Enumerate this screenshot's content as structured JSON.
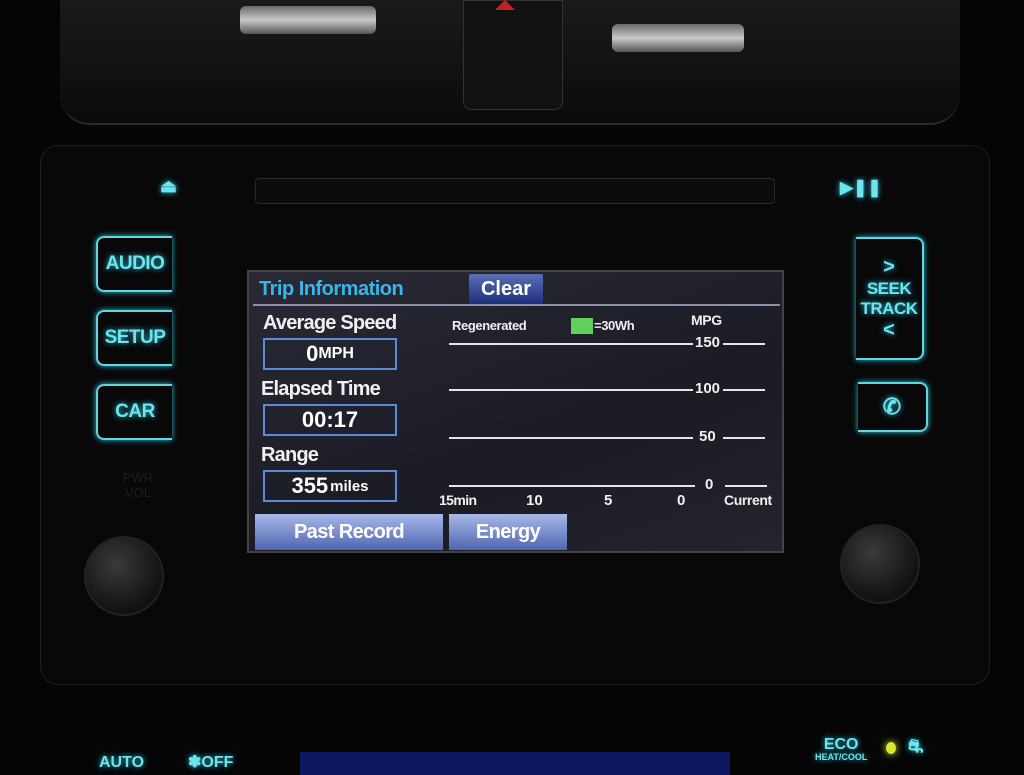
{
  "head_unit": {
    "eject_icon": "eject-icon",
    "play_pause_icon": "play-pause-icon",
    "left_buttons": [
      {
        "label": "AUDIO"
      },
      {
        "label": "SETUP"
      },
      {
        "label": "CAR"
      }
    ],
    "seek_track": {
      "line1": "SEEK",
      "line2": "TRACK"
    },
    "phone_icon": "phone-icon",
    "pwr_vol_label": "PWR VOL",
    "accent_color": "#5fd8e4"
  },
  "screen": {
    "title": "Trip Information",
    "clear_button": "Clear",
    "average_speed": {
      "label": "Average Speed",
      "value": "0",
      "unit": "MPH"
    },
    "elapsed_time": {
      "label": "Elapsed Time",
      "value": "00:17"
    },
    "range": {
      "label": "Range",
      "value": "355",
      "unit": "miles"
    },
    "tabs": [
      {
        "label": "Past Record"
      },
      {
        "label": "Energy"
      }
    ],
    "chart": {
      "regenerated_label": "Regenerated",
      "legend_value": "=30Wh",
      "legend_color": "#5fd05a",
      "y_label": "MPG",
      "y_ticks": [
        "150",
        "100",
        "50",
        "0"
      ],
      "x_ticks": [
        "15min",
        "10",
        "5",
        "0"
      ],
      "current_label": "Current"
    }
  },
  "climate": {
    "auto": "AUTO",
    "fan_off": "OFF",
    "eco": "ECO",
    "heat_cool": "HEAT/COOL"
  }
}
